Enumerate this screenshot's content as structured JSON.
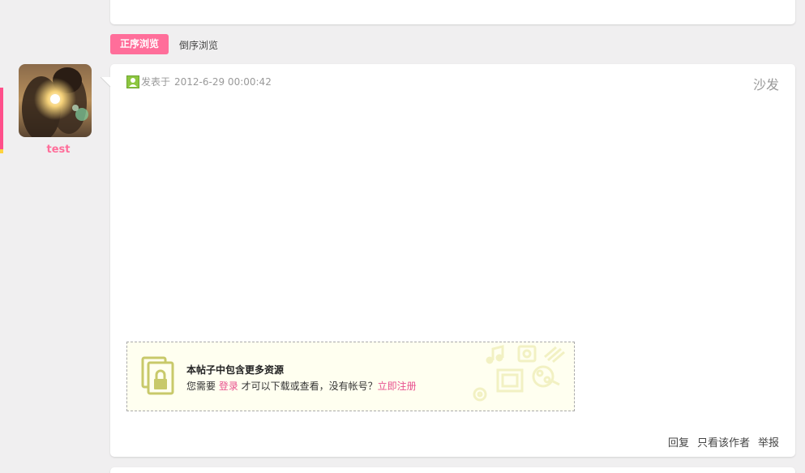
{
  "sort": {
    "active_label": "正序浏览",
    "inactive_label": "倒序浏览"
  },
  "author": {
    "name": "test"
  },
  "post": {
    "meta_prefix": "发表于",
    "date": "2012-6-29 00:00:42",
    "floor": "沙发",
    "locked": {
      "title": "本帖子中包含更多资源",
      "line_before": "您需要 ",
      "login_link": "登录",
      "line_middle": " 才可以下载或查看，没有帐号？",
      "register_link": "立即注册"
    },
    "actions": [
      "回复",
      "只看该作者",
      "举报"
    ]
  },
  "colors": {
    "accent": "#ff6e9a",
    "link": "#e8508e",
    "page_bg": "#f0eff0"
  }
}
